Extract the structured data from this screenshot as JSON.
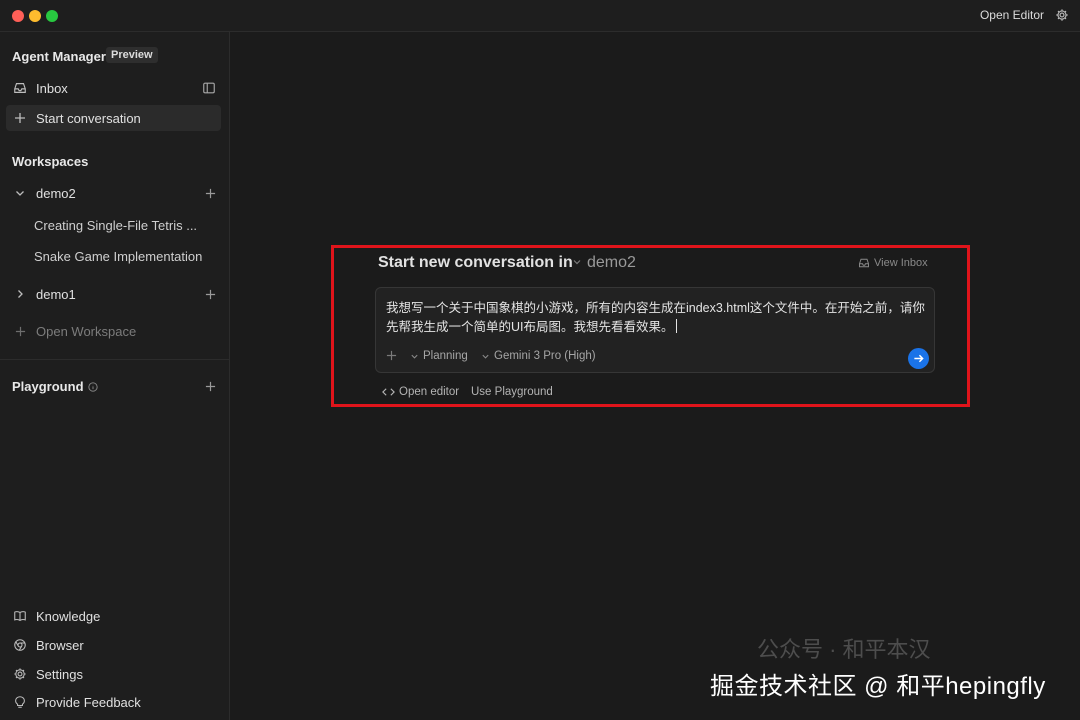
{
  "titlebar": {
    "open_editor": "Open Editor"
  },
  "sidebar": {
    "title": "Agent Manager",
    "preview_badge": "Preview",
    "inbox": "Inbox",
    "start_conversation": "Start conversation",
    "workspaces_heading": "Workspaces",
    "workspaces": [
      {
        "name": "demo2",
        "expanded": true,
        "conversations": [
          "Creating Single-File Tetris ...",
          "Snake Game Implementation"
        ]
      },
      {
        "name": "demo1",
        "expanded": false,
        "conversations": []
      }
    ],
    "open_workspace": "Open Workspace",
    "playground": "Playground",
    "bottom": [
      "Knowledge",
      "Browser",
      "Settings",
      "Provide Feedback"
    ]
  },
  "main": {
    "title_prefix": "Start new conversation in",
    "workspace": "demo2",
    "view_inbox": "View Inbox",
    "input_text": "我想写一个关于中国象棋的小游戏，所有的内容生成在index3.html这个文件中。在开始之前，请你先帮我生成一个简单的UI布局图。我想先看看效果。",
    "mode": "Planning",
    "model": "Gemini 3 Pro (High)",
    "open_editor": "Open editor",
    "use_playground": "Use Playground"
  },
  "watermark": {
    "faint": "公众号 · 和平本汉",
    "main": "掘金技术社区 @ 和平hepingfly"
  },
  "colors": {
    "accent": "#1a73e8",
    "highlight_border": "#e0141b"
  }
}
